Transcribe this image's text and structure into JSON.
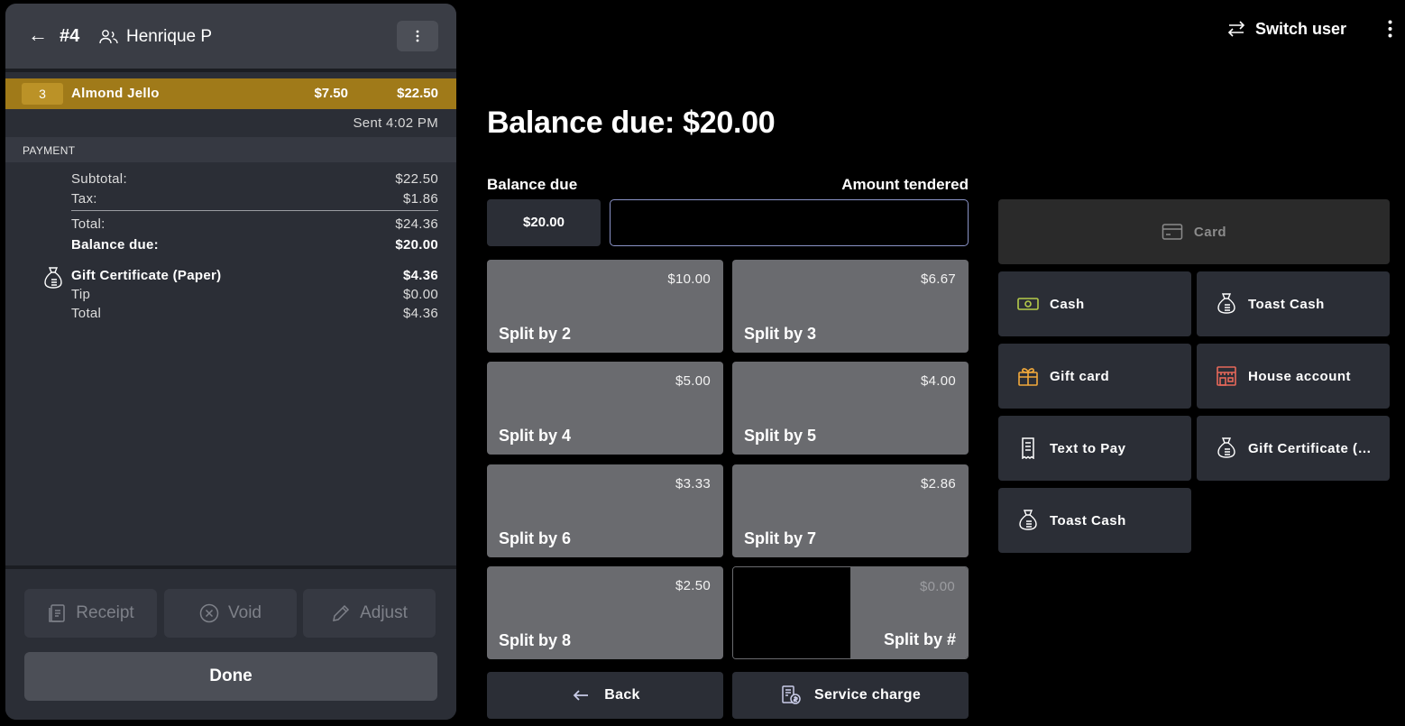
{
  "header": {
    "order_number": "#4",
    "server_name": "Henrique P",
    "switch_user_label": "Switch user"
  },
  "order_items": [
    {
      "qty": "3",
      "name": "Almond Jello",
      "unit_price": "$7.50",
      "total": "$22.50"
    }
  ],
  "sent_time": "Sent 4:02 PM",
  "payment": {
    "section_label": "PAYMENT",
    "subtotal_label": "Subtotal:",
    "subtotal": "$22.50",
    "tax_label": "Tax:",
    "tax": "$1.86",
    "total_label": "Total:",
    "total": "$24.36",
    "balance_label": "Balance due:",
    "balance": "$20.00",
    "applied": {
      "name": "Gift Certificate (Paper)",
      "amount": "$4.36",
      "tip_label": "Tip",
      "tip": "$0.00",
      "total_label": "Total",
      "total": "$4.36"
    }
  },
  "footer": {
    "receipt_label": "Receipt",
    "void_label": "Void",
    "adjust_label": "Adjust",
    "done_label": "Done"
  },
  "checkout": {
    "title": "Balance due: $20.00",
    "balance_due_label": "Balance due",
    "amount_tendered_label": "Amount tendered",
    "balance_due_value": "$20.00",
    "amount_tendered_value": ""
  },
  "splits": [
    {
      "label": "Split by 2",
      "amount": "$10.00"
    },
    {
      "label": "Split by 3",
      "amount": "$6.67"
    },
    {
      "label": "Split by 4",
      "amount": "$5.00"
    },
    {
      "label": "Split by 5",
      "amount": "$4.00"
    },
    {
      "label": "Split by 6",
      "amount": "$3.33"
    },
    {
      "label": "Split by 7",
      "amount": "$2.86"
    },
    {
      "label": "Split by 8",
      "amount": "$2.50"
    },
    {
      "label": "Split by #",
      "amount": "$0.00"
    }
  ],
  "bottom_actions": {
    "back_label": "Back",
    "service_charge_label": "Service charge"
  },
  "payment_methods": {
    "card": {
      "label": "Card",
      "icon": "credit-card-icon",
      "enabled": false
    },
    "items": [
      {
        "label": "Cash",
        "icon": "cash-icon",
        "color": "#b5cc4a"
      },
      {
        "label": "Toast Cash",
        "icon": "money-bag-icon",
        "color": "#ffffff"
      },
      {
        "label": "Gift card",
        "icon": "gift-icon",
        "color": "#f2a93b"
      },
      {
        "label": "House account",
        "icon": "storefront-icon",
        "color": "#e8685a"
      },
      {
        "label": "Text to Pay",
        "icon": "receipt-icon",
        "color": "#ffffff"
      },
      {
        "label": "Gift Certificate (…",
        "icon": "money-bag-icon",
        "color": "#ffffff"
      },
      {
        "label": "Toast Cash",
        "icon": "money-bag-icon",
        "color": "#ffffff"
      }
    ]
  }
}
